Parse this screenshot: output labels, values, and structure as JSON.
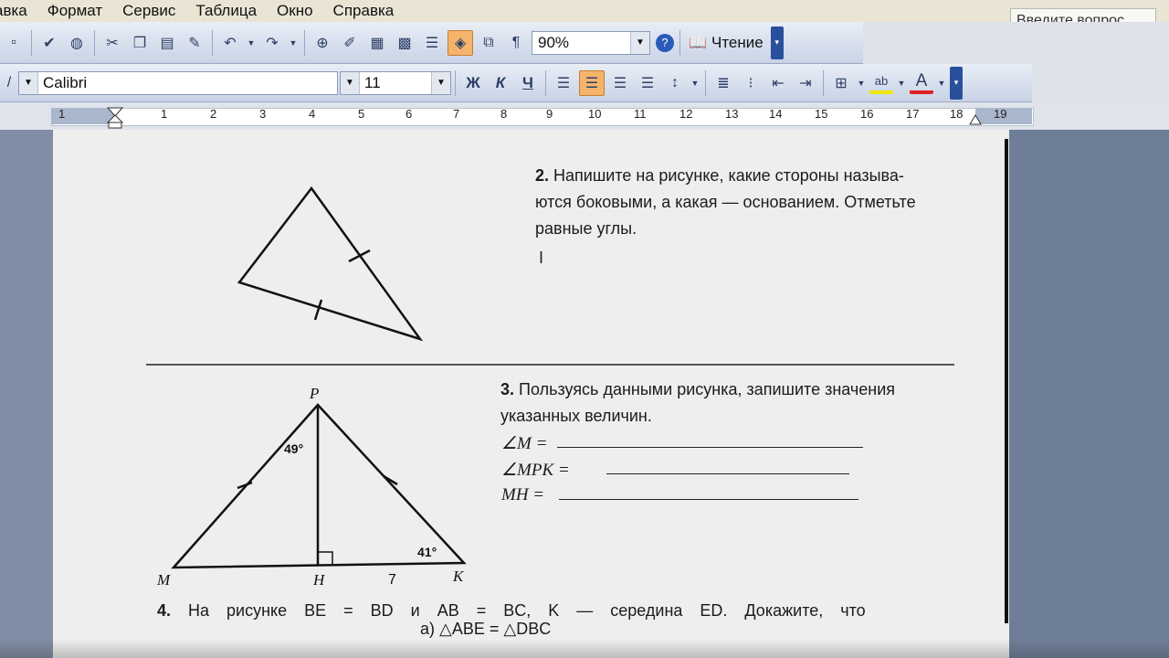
{
  "menubar": {
    "items": [
      "авка",
      "Формат",
      "Сервис",
      "Таблица",
      "Окно",
      "Справка"
    ]
  },
  "help_box": {
    "placeholder": "Введите вопрос"
  },
  "toolbar": {
    "zoom_value": "90%",
    "reading_label": "Чтение",
    "icons": [
      "spelling-icon",
      "research-icon",
      "cut-icon",
      "copy-icon",
      "paste-icon",
      "format-painter-icon",
      "undo-icon",
      "redo-icon",
      "hyperlink-icon",
      "tables-borders-icon",
      "insert-table-icon",
      "insert-excel-icon",
      "columns-icon",
      "drawing-icon",
      "document-map-icon",
      "show-formatting-icon",
      "help-icon",
      "reading-icon"
    ]
  },
  "format_bar": {
    "font_name": "Calibri",
    "font_size": "11",
    "bold": "Ж",
    "italic": "К",
    "underline": "Ч",
    "highlight_label": "ab",
    "font_color_label": "A"
  },
  "ruler": {
    "numbers": [
      "1",
      "1",
      "2",
      "3",
      "4",
      "5",
      "6",
      "7",
      "8",
      "9",
      "10",
      "11",
      "12",
      "13",
      "14",
      "15",
      "16",
      "17",
      "18",
      "19"
    ]
  },
  "document": {
    "task2": {
      "number": "2.",
      "lines": [
        "Напишите на рисунке, какие стороны называ-",
        "ются боковыми, а какая — основанием. Отметьте",
        "равные углы."
      ]
    },
    "task3": {
      "number": "3.",
      "lines": [
        "Пользуясь данными рисунка, запишите значения",
        "указанных величин."
      ],
      "fields": [
        "∠M =",
        "∠MPK =",
        "MH ="
      ]
    },
    "task4": {
      "number": "4.",
      "text": "На рисунке BE = BD и AB = BC, K — середина ED. Докажите, что",
      "sub": "а) △ABE = △DBC"
    },
    "figure3": {
      "vertices": [
        "P",
        "M",
        "H",
        "K"
      ],
      "angle_p": "49°",
      "angle_k": "41°",
      "segment_hk": "7"
    }
  }
}
